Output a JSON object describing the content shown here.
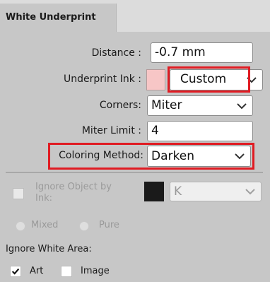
{
  "tab": {
    "title": "White Underprint"
  },
  "fields": {
    "distance_label": "Distance :",
    "distance_value": "-0.7 mm",
    "ink_label": "Underprint Ink :",
    "ink_swatch_color": "#f7c6c6",
    "ink_value": "Custom",
    "corners_label": "Corners:",
    "corners_value": "Miter",
    "miter_label": "Miter Limit :",
    "miter_value": "4",
    "coloring_label": "Coloring Method:",
    "coloring_value": "Darken"
  },
  "ignore_ink": {
    "label_line1": "Ignore Object by",
    "label_line2": "Ink:",
    "swatch_color": "#1a1a1a",
    "value": "K",
    "mixed_label": "Mixed",
    "pure_label": "Pure"
  },
  "ignore_white": {
    "title": "Ignore White Area:",
    "art_label": "Art",
    "art_checked": true,
    "image_label": "Image",
    "image_checked": false
  },
  "colors": {
    "highlight": "#e01b22",
    "panel": "#c7c7c7"
  }
}
